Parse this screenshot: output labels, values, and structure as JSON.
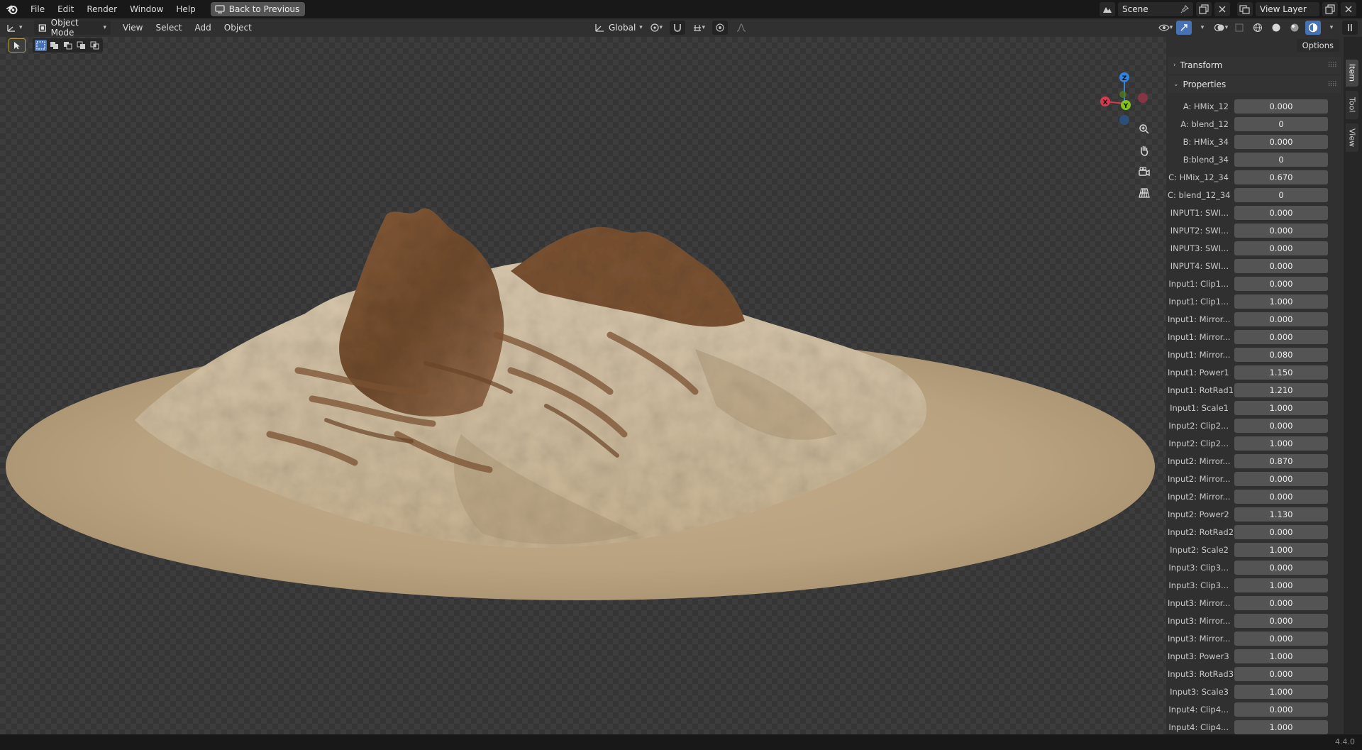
{
  "topbar": {
    "menus": [
      "File",
      "Edit",
      "Render",
      "Window",
      "Help"
    ],
    "back_button": "Back to Previous",
    "scene": "Scene",
    "view_layer": "View Layer"
  },
  "viewport_header": {
    "mode": "Object Mode",
    "menus": [
      "View",
      "Select",
      "Add",
      "Object"
    ],
    "orientation": "Global",
    "options": "Options"
  },
  "gizmo": {
    "x": "X",
    "y": "Y",
    "z": "Z"
  },
  "panels": {
    "transform": "Transform",
    "properties": "Properties"
  },
  "properties": [
    {
      "label": "A: HMix_12",
      "value": "0.000"
    },
    {
      "label": "A: blend_12",
      "value": "0"
    },
    {
      "label": "B: HMix_34",
      "value": "0.000"
    },
    {
      "label": "B:blend_34",
      "value": "0"
    },
    {
      "label": "C: HMix_12_34",
      "value": "0.670"
    },
    {
      "label": "C: blend_12_34",
      "value": "0"
    },
    {
      "label": "INPUT1: SWI...",
      "value": "0.000"
    },
    {
      "label": "INPUT2: SWI...",
      "value": "0.000"
    },
    {
      "label": "INPUT3: SWI...",
      "value": "0.000"
    },
    {
      "label": "INPUT4: SWI...",
      "value": "0.000"
    },
    {
      "label": "Input1: Clip1...",
      "value": "0.000"
    },
    {
      "label": "Input1: Clip1...",
      "value": "1.000"
    },
    {
      "label": "Input1: Mirror...",
      "value": "0.000"
    },
    {
      "label": "Input1: Mirror...",
      "value": "0.000"
    },
    {
      "label": "Input1: Mirror...",
      "value": "0.080"
    },
    {
      "label": "Input1: Power1",
      "value": "1.150"
    },
    {
      "label": "Input1: RotRad1",
      "value": "1.210"
    },
    {
      "label": "Input1: Scale1",
      "value": "1.000"
    },
    {
      "label": "Input2: Clip2...",
      "value": "0.000"
    },
    {
      "label": "Input2: Clip2...",
      "value": "1.000"
    },
    {
      "label": "Input2: Mirror...",
      "value": "0.870"
    },
    {
      "label": "Input2: Mirror...",
      "value": "0.000"
    },
    {
      "label": "Input2: Mirror...",
      "value": "0.000"
    },
    {
      "label": "Input2: Power2",
      "value": "1.130"
    },
    {
      "label": "Input2: RotRad2",
      "value": "0.000"
    },
    {
      "label": "Input2: Scale2",
      "value": "1.000"
    },
    {
      "label": "Input3: Clip3...",
      "value": "0.000"
    },
    {
      "label": "Input3: Clip3...",
      "value": "1.000"
    },
    {
      "label": "Input3: Mirror...",
      "value": "0.000"
    },
    {
      "label": "Input3: Mirror...",
      "value": "0.000"
    },
    {
      "label": "Input3: Mirror...",
      "value": "0.000"
    },
    {
      "label": "Input3: Power3",
      "value": "1.000"
    },
    {
      "label": "Input3: RotRad3",
      "value": "0.000"
    },
    {
      "label": "Input3: Scale3",
      "value": "1.000"
    },
    {
      "label": "Input4: Clip4...",
      "value": "0.000"
    },
    {
      "label": "Input4: Clip4...",
      "value": "1.000"
    }
  ],
  "side_tabs": [
    "Item",
    "Tool",
    "View"
  ],
  "status": {
    "version": "4.4.0"
  },
  "colors": {
    "accent": "#4772b3",
    "axis_x": "#d8394e",
    "axis_y": "#7fc31c",
    "axis_z": "#2f83e3",
    "sand": "#b9a382",
    "rock": "#7c5232"
  }
}
